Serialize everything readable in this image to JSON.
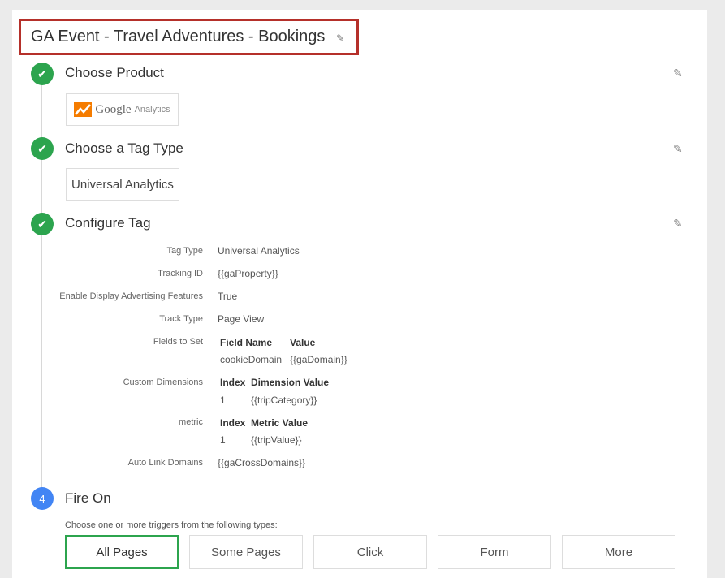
{
  "tag": {
    "title": "GA Event - Travel Adventures - Bookings"
  },
  "steps": {
    "product": {
      "title": "Choose Product",
      "google": "Google",
      "analytics": "Analytics"
    },
    "tag_type": {
      "title": "Choose a Tag Type",
      "value": "Universal Analytics"
    },
    "configure": {
      "title": "Configure Tag",
      "fields": [
        {
          "label": "Tag Type",
          "value": "Universal Analytics"
        },
        {
          "label": "Tracking ID",
          "value": "{{gaProperty}}"
        },
        {
          "label": "Enable Display Advertising Features",
          "value": "True"
        },
        {
          "label": "Track Type",
          "value": "Page View"
        }
      ],
      "fields_to_set": {
        "label": "Fields to Set",
        "headers": [
          "Field Name",
          "Value"
        ],
        "rows": [
          [
            "cookieDomain",
            "{{gaDomain}}"
          ]
        ]
      },
      "custom_dimensions": {
        "label": "Custom Dimensions",
        "headers": [
          "Index",
          "Dimension Value"
        ],
        "rows": [
          [
            "1",
            "{{tripCategory}}"
          ]
        ]
      },
      "metric": {
        "label": "metric",
        "headers": [
          "Index",
          "Metric Value"
        ],
        "rows": [
          [
            "1",
            "{{tripValue}}"
          ]
        ]
      },
      "auto_link": {
        "label": "Auto Link Domains",
        "value": "{{gaCrossDomains}}"
      }
    },
    "fire_on": {
      "number": "4",
      "title": "Fire On",
      "hint": "Choose one or more triggers from the following types:",
      "triggers": [
        "All Pages",
        "Some Pages",
        "Click",
        "Form",
        "More"
      ]
    }
  },
  "icons": {
    "check": "check-icon",
    "edit": "pencil-icon"
  },
  "colors": {
    "done": "#2ca44e",
    "pending": "#4285f4",
    "highlight_border": "#b5302a"
  }
}
